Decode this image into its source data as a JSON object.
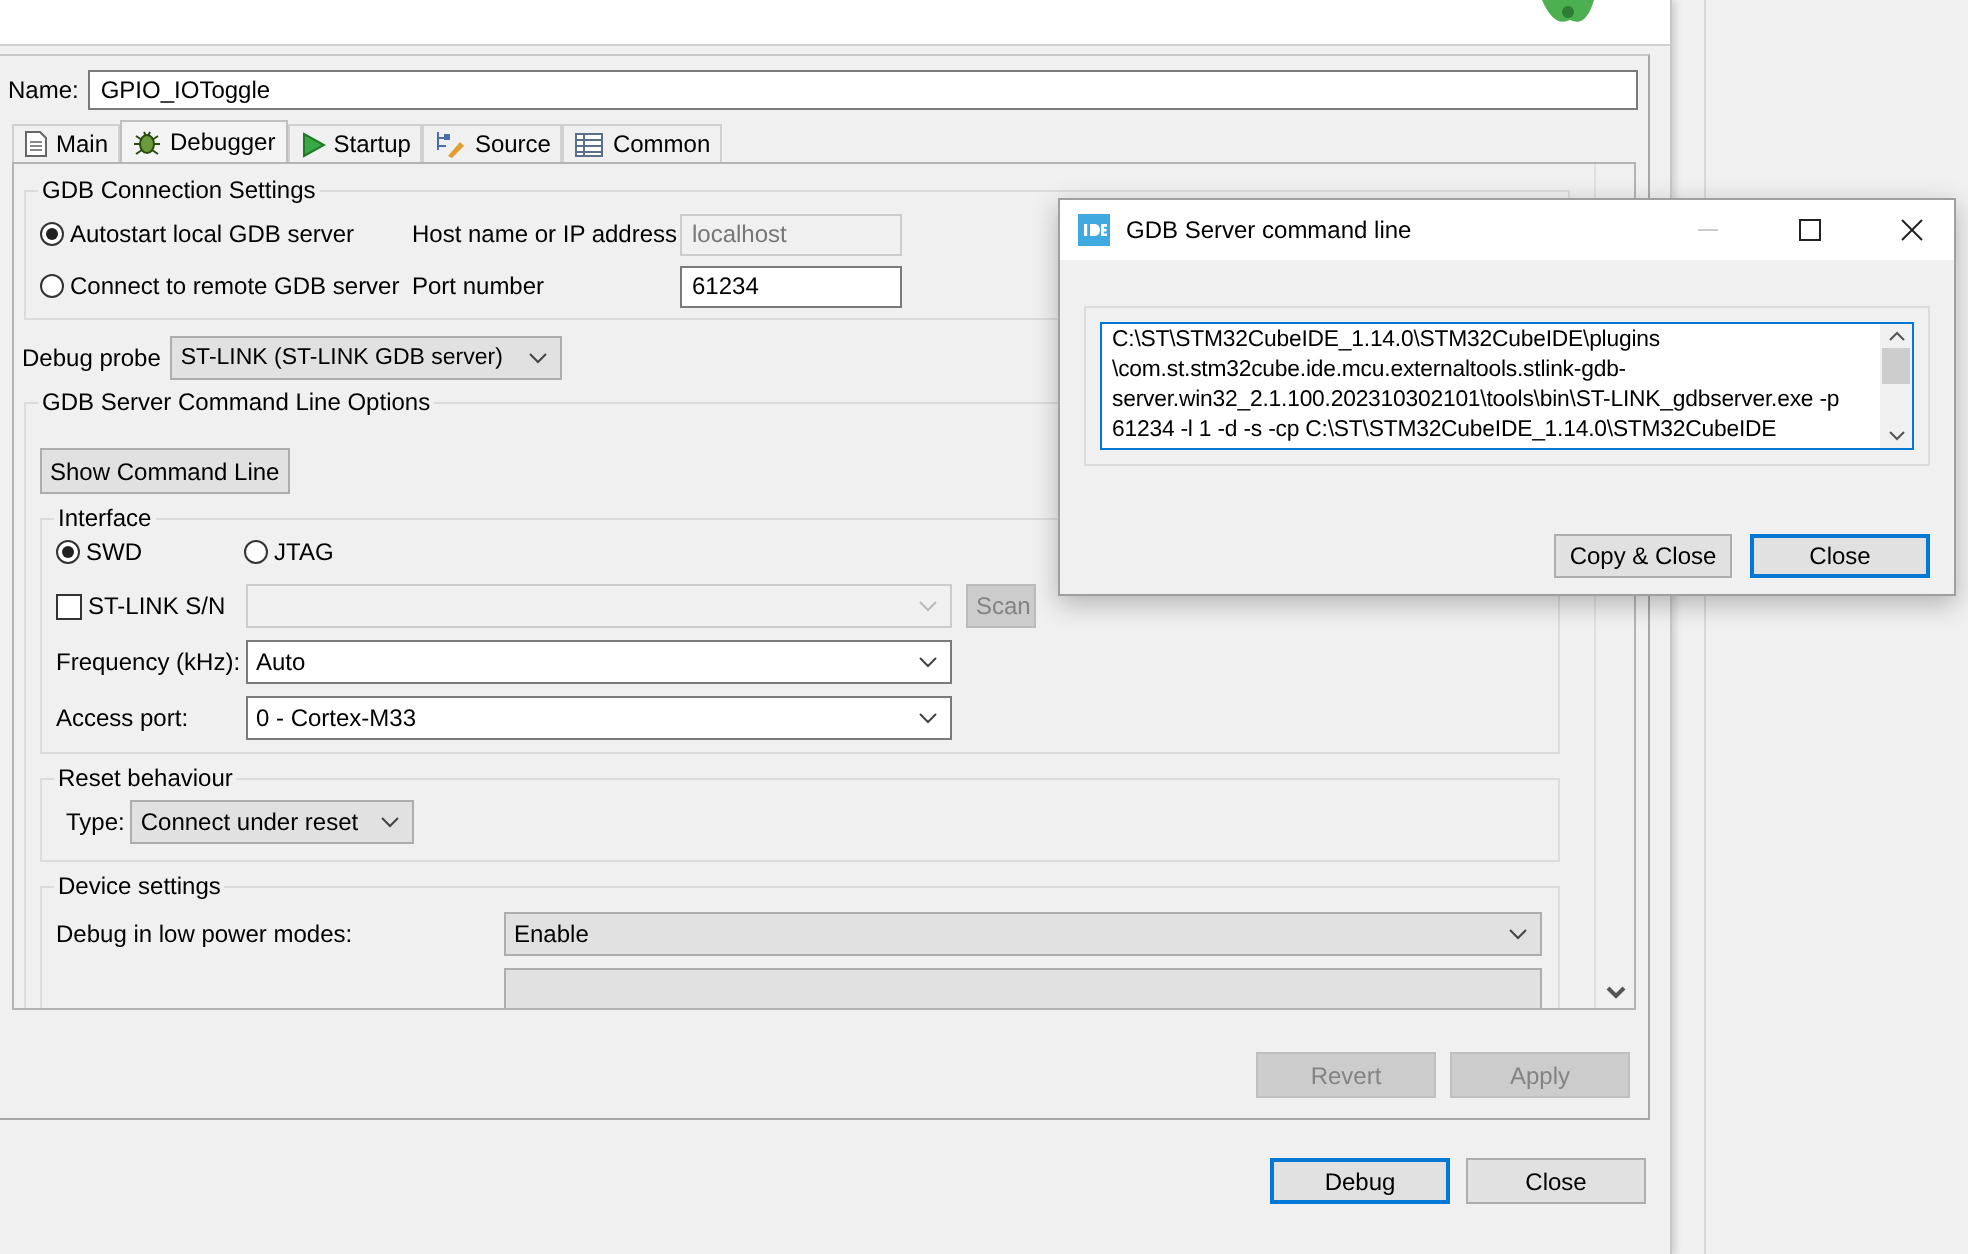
{
  "name_field": {
    "label": "Name:",
    "value": "GPIO_IOToggle"
  },
  "tabs": [
    {
      "label": "Main",
      "selected": false
    },
    {
      "label": "Debugger",
      "selected": true
    },
    {
      "label": "Startup",
      "selected": false
    },
    {
      "label": "Source",
      "selected": false
    },
    {
      "label": "Common",
      "selected": false
    }
  ],
  "gdb_connection": {
    "title": "GDB Connection Settings",
    "options": [
      {
        "label": "Autostart local GDB server",
        "selected": true
      },
      {
        "label": "Connect to remote GDB server",
        "selected": false
      }
    ],
    "host": {
      "label": "Host name or IP address",
      "value": "localhost",
      "disabled": true
    },
    "port": {
      "label": "Port number",
      "value": "61234",
      "disabled": false
    }
  },
  "debug_probe": {
    "label": "Debug probe",
    "value": "ST-LINK (ST-LINK GDB server)"
  },
  "command_line_options": {
    "title": "GDB Server Command Line Options",
    "show_button": "Show Command Line",
    "interface": {
      "title": "Interface",
      "modes": [
        {
          "label": "SWD",
          "selected": true
        },
        {
          "label": "JTAG",
          "selected": false
        }
      ],
      "serial": {
        "label": "ST-LINK S/N",
        "checked": false,
        "scan": "Scan"
      },
      "frequency": {
        "label": "Frequency (kHz):",
        "value": "Auto"
      },
      "access_port": {
        "label": "Access port:",
        "value": "0 - Cortex-M33"
      }
    },
    "reset": {
      "title": "Reset behaviour",
      "type_label": "Type:",
      "value": "Connect under reset"
    },
    "device": {
      "title": "Device settings",
      "rows": [
        {
          "label": "Debug in low power modes:",
          "value": "Enable"
        }
      ]
    }
  },
  "apply_buttons": [
    {
      "label": "Revert",
      "disabled": true
    },
    {
      "label": "Apply",
      "disabled": true
    }
  ],
  "dialog_buttons": [
    {
      "label": "Debug",
      "default": true
    },
    {
      "label": "Close",
      "default": false
    }
  ],
  "popup": {
    "title": "GDB Server command line",
    "lines": [
      "C:\\ST\\STM32CubeIDE_1.14.0\\STM32CubeIDE\\plugins",
      "\\com.st.stm32cube.ide.mcu.externaltools.stlink-gdb-",
      "server.win32_2.1.100.202310302101\\tools\\bin\\ST-LINK_gdbserver.exe -p",
      "61234 -l 1 -d -s -cp C:\\ST\\STM32CubeIDE_1.14.0\\STM32CubeIDE"
    ],
    "buttons": [
      {
        "label": "Copy & Close",
        "default": false
      },
      {
        "label": "Close",
        "default": true
      }
    ]
  }
}
